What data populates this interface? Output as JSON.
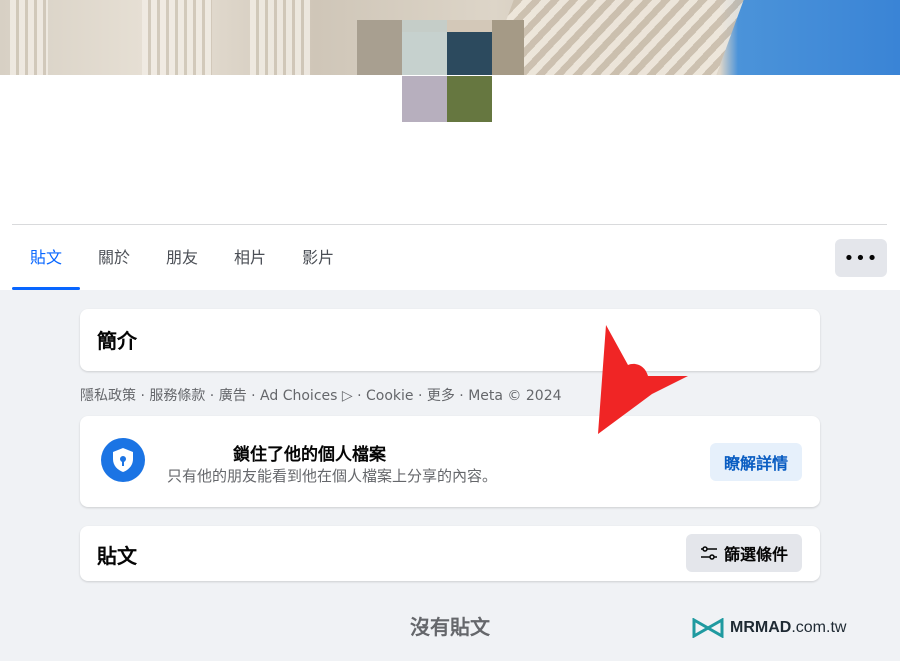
{
  "tabs": [
    {
      "label": "貼文",
      "active": true
    },
    {
      "label": "關於",
      "active": false
    },
    {
      "label": "朋友",
      "active": false
    },
    {
      "label": "相片",
      "active": false
    },
    {
      "label": "影片",
      "active": false
    }
  ],
  "more_button": {
    "label": "•••"
  },
  "intro": {
    "title": "簡介"
  },
  "footer": {
    "links": "隱私政策 · 服務條款 · 廣告 · Ad Choices ▷ · Cookie · 更多 · Meta © 2024"
  },
  "locked_profile": {
    "title": "鎖住了他的個人檔案",
    "subtitle": "只有他的朋友能看到他在個人檔案上分享的內容。",
    "learn_more": "瞭解詳情",
    "icon": "shield-lock-icon"
  },
  "posts": {
    "title": "貼文",
    "filter_label": "篩選條件",
    "empty_text": "沒有貼文"
  },
  "watermark": {
    "brand": "MRMAD",
    "tld": ".com.tw"
  },
  "colors": {
    "accent": "#0866ff",
    "annotation_arrow": "#f02525",
    "shield": "#1b74e4"
  }
}
